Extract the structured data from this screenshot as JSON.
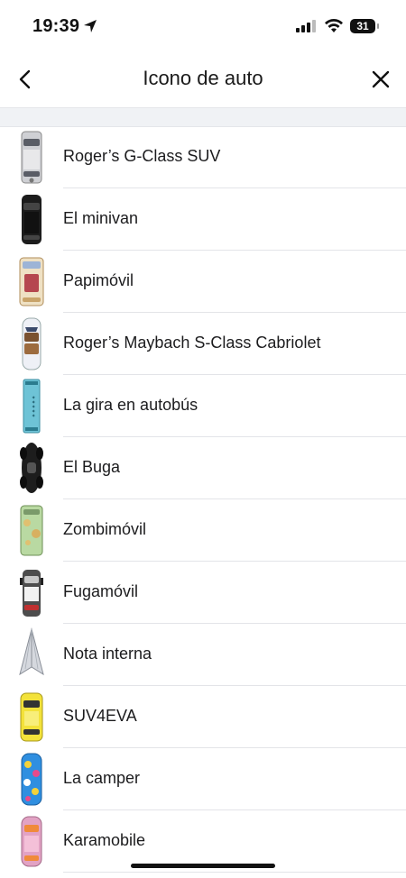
{
  "status": {
    "time": "19:39",
    "battery": "31"
  },
  "nav": {
    "title": "Icono de auto",
    "back_icon": "chevron-left-icon",
    "close_icon": "close-icon"
  },
  "items": [
    {
      "label": "Roger’s G-Class SUV",
      "icon": "gclass-suv-icon",
      "color": "#d6d6d6"
    },
    {
      "label": "El minivan",
      "icon": "minivan-icon",
      "color": "#1a1a1a"
    },
    {
      "label": "Papimóvil",
      "icon": "papimovil-icon",
      "color": "#f0d9b0"
    },
    {
      "label": "Roger’s Maybach S-Class Cabriolet",
      "icon": "maybach-icon",
      "color": "#e8ecf4"
    },
    {
      "label": "La gira en autobús",
      "icon": "bus-icon",
      "color": "#6ec3d6"
    },
    {
      "label": "El Buga",
      "icon": "buga-icon",
      "color": "#222222"
    },
    {
      "label": "Zombimóvil",
      "icon": "zombimovil-icon",
      "color": "#b7d6a0"
    },
    {
      "label": "Fugamóvil",
      "icon": "fugamovil-icon",
      "color": "#4a4a4a"
    },
    {
      "label": "Nota interna",
      "icon": "paper-plane-icon",
      "color": "#c9ccd2"
    },
    {
      "label": "SUV4EVA",
      "icon": "suv4eva-icon",
      "color": "#f4e23a"
    },
    {
      "label": "La camper",
      "icon": "camper-icon",
      "color": "#2f8fe0"
    },
    {
      "label": "Karamobile",
      "icon": "karamobile-icon",
      "color": "#e0a0c0"
    }
  ]
}
